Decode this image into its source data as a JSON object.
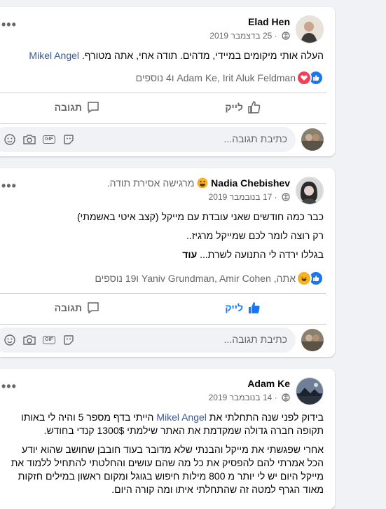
{
  "posts": [
    {
      "author": "Elad Hen",
      "feeling": "",
      "date": "25 בדצמבר 2019",
      "text_parts": [
        "העלה אותי מיקומים במיידי, מדהים. תודה אחי, אתה מטורף. ",
        "Mikel Angel"
      ],
      "reactions_text": "Adam Ke, Irit Aluk Feldman ו4 נוספים",
      "reaction_icons": [
        "like",
        "love"
      ],
      "like_label": "לייק",
      "comment_label": "תגובה",
      "liked": false,
      "comment_placeholder": "כתיבת תגובה..."
    },
    {
      "author": "Nadia Chebishev",
      "feeling": "מרגישה אסירת תודה.",
      "date": "17 בנובמבר 2019",
      "paragraphs": [
        "כבר כמה חודשים שאני עובדת עם מייקל (קצב איטי באשמתי)",
        "רק רוצה לומר לכם שמייקל מרגיז..",
        "בגללו ירדה לי התנועה לשרת... "
      ],
      "more_label": "עוד",
      "reactions_text": "אתה, Yaniv Grundman, Amir Cohen ו19 נוספים",
      "reaction_icons": [
        "like",
        "haha"
      ],
      "like_label": "לייק",
      "comment_label": "תגובה",
      "liked": true,
      "comment_placeholder": "כתיבת תגובה..."
    },
    {
      "author": "Adam Ke",
      "date": "14 בנובמבר 2019",
      "p1_parts": [
        "בידוק לפני שנה התחלתי את ",
        "Mikel Angel",
        " הייתי בדף מספר 5 והיה לי באותו תקופה חברה גדולה שמקדמת את האתר שילמתי 1300$ קנדי בחודש."
      ],
      "p2": "אחרי שפגשתי את מייקל והבנתי שלא מדובר בעוד חובבן שחושב שהוא יודע הכל אמרתי להם להפסיק את כל מה שהם עושים והחלטתי להתחיל ללמוד את מייקל היום יש לי יותר מ 800 מילות חיפוש בגוגל ומקום ראשון במילים חזקות מאוד הגרף למטה זה שהתחלתי איתו ומה קורה היום."
    }
  ],
  "colors": {
    "link": "#385898",
    "like_blue": "#1877f2",
    "love_red": "#f33e58",
    "haha_yellow": "#f7b125"
  },
  "icons": [
    "more-dots-icon",
    "globe-icon",
    "like-thumb-icon",
    "comment-bubble-icon",
    "sticker-icon",
    "gif-icon",
    "camera-icon",
    "emoji-icon",
    "like-reaction-icon",
    "love-reaction-icon",
    "haha-reaction-icon",
    "grinning-emoji-icon"
  ]
}
